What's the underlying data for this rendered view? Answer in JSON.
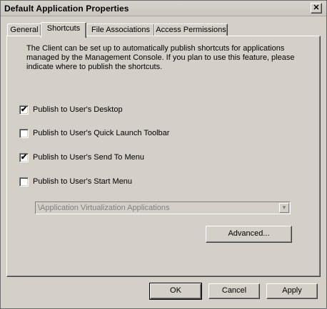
{
  "window": {
    "title": "Default Application Properties",
    "close_glyph": "✕"
  },
  "tabs": [
    {
      "label": "General",
      "active": false
    },
    {
      "label": "Shortcuts",
      "active": true
    },
    {
      "label": "File Associations",
      "active": false
    },
    {
      "label": "Access Permissions",
      "active": false
    }
  ],
  "shortcuts": {
    "description": "The Client can be set up to automatically publish shortcuts for applications managed by the Management Console.  If you plan to use this feature, please indicate where to publish the shortcuts.",
    "options": [
      {
        "label": "Publish to User's Desktop",
        "checked": true
      },
      {
        "label": "Publish to User's Quick Launch Toolbar",
        "checked": false
      },
      {
        "label": "Publish to User's Send To Menu",
        "checked": true
      },
      {
        "label": "Publish to User's Start Menu",
        "checked": false
      }
    ],
    "start_menu_folder": {
      "value": "\\Application Virtualization Applications",
      "enabled": false
    },
    "advanced_label": "Advanced..."
  },
  "footer": {
    "ok_label": "OK",
    "cancel_label": "Cancel",
    "apply_label": "Apply"
  },
  "icons": {
    "close": "close-icon",
    "dropdown": "chevron-down-icon",
    "check": "check-icon"
  }
}
